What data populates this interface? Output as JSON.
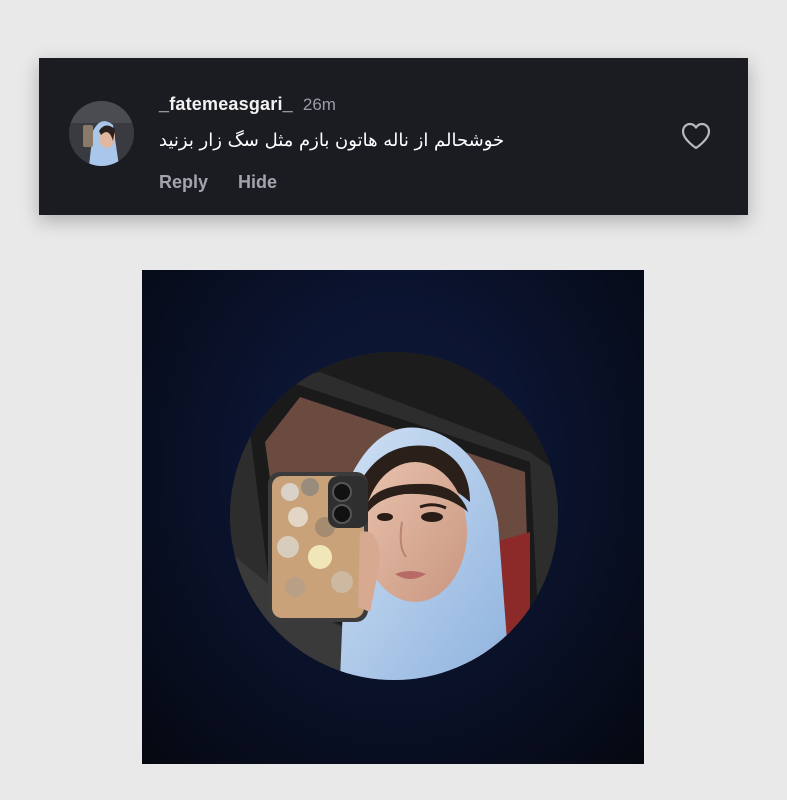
{
  "comment": {
    "username": "_fatemeasgari_",
    "timestamp": "26m",
    "text": "خوشحالم از ناله هاتون بازم مثل سگ زار بزنید",
    "reply_label": "Reply",
    "hide_label": "Hide",
    "avatar_icon": "profile-photo",
    "like_icon": "heart-outline-icon"
  },
  "colors": {
    "card_background": "#1b1c22",
    "page_background": "#e9e9e9",
    "hijab": "#a9c7ea",
    "image_background": "#0b1430"
  }
}
